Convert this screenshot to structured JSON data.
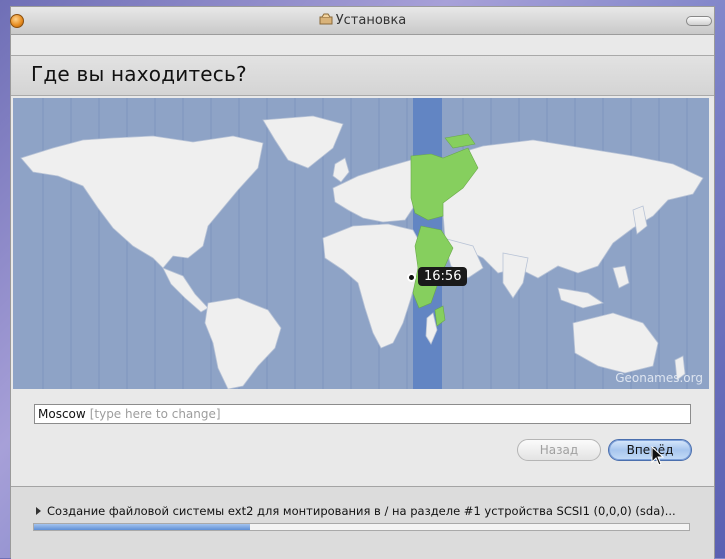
{
  "window": {
    "title": "Установка"
  },
  "header": {
    "title": "Где вы находитесь?"
  },
  "map": {
    "selected_time": "16:56",
    "credit": "Geonames.org"
  },
  "location": {
    "value": "Moscow",
    "placeholder": "[type here to change]"
  },
  "buttons": {
    "back": "Назад",
    "forward": "Вперёд"
  },
  "status": {
    "text": "Создание файловой системы ext2 для монтирования в / на разделе #1 устройства SCSI1 (0,0,0) (sda)...",
    "progress": 0.33
  }
}
